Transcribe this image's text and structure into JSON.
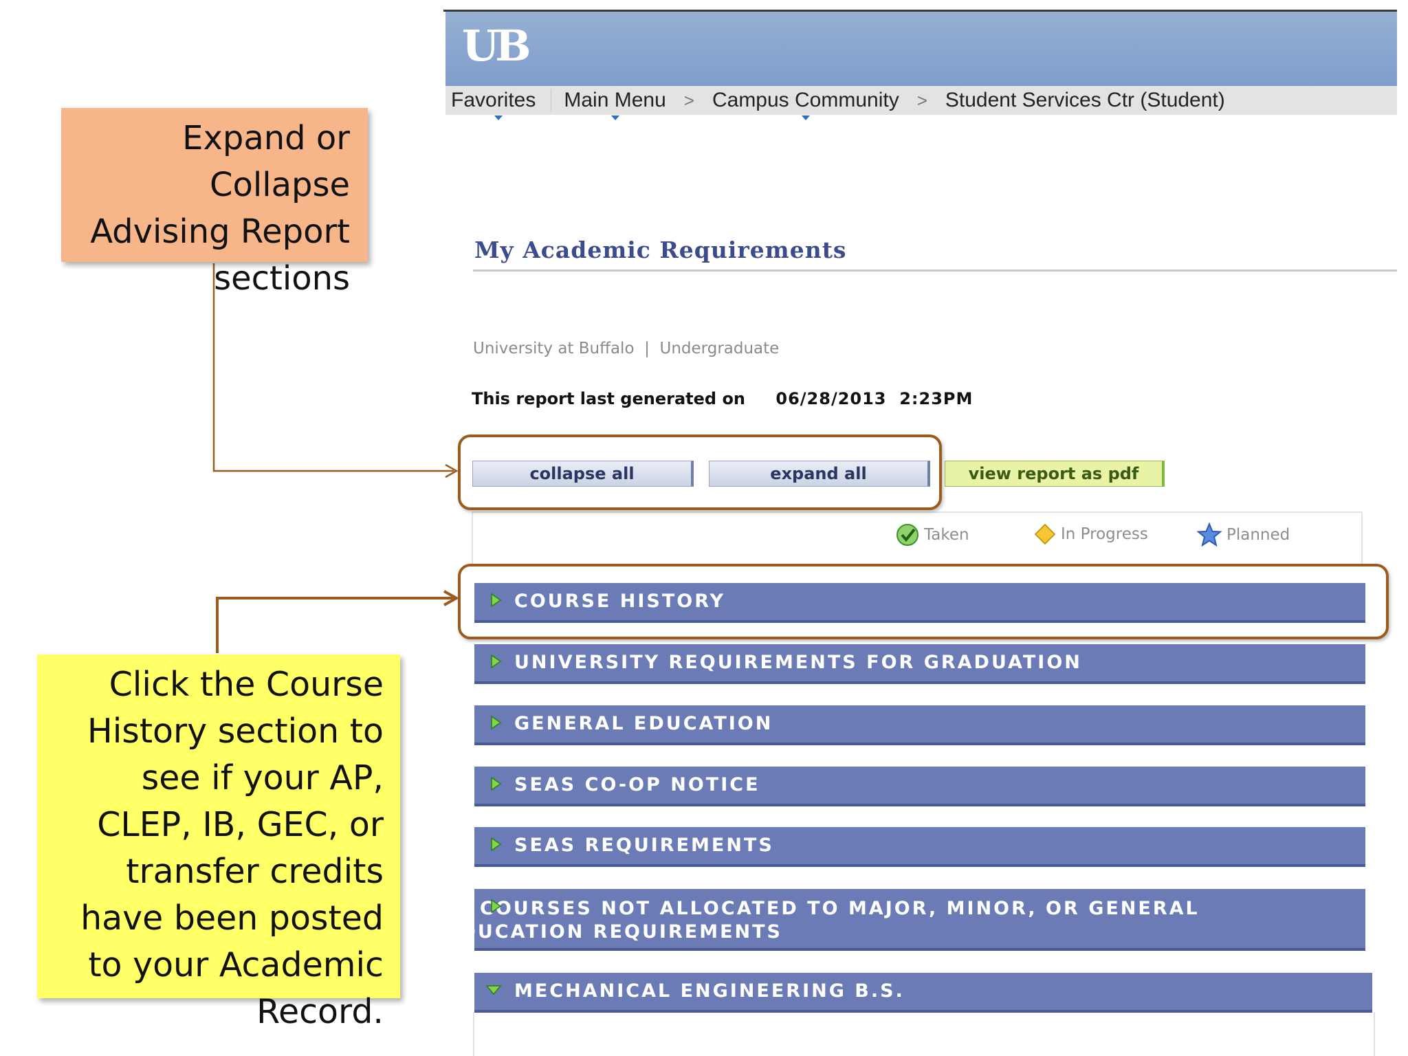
{
  "header": {
    "logo_text": "UB",
    "nav": [
      "Favorites",
      "Main Menu",
      "Campus Community",
      "Student Services Ctr (Student)"
    ],
    "nav_separator": ">"
  },
  "page": {
    "title": "My Academic Requirements",
    "institution_line": "University at Buffalo  |  Undergraduate",
    "generated_label": "This report last generated on",
    "generated_date": "06/28/2013  2:23PM"
  },
  "buttons": {
    "collapse_all": "collapse all",
    "expand_all": "expand all",
    "view_pdf": "view report as pdf"
  },
  "legend": {
    "taken": "Taken",
    "in_progress": "In Progress",
    "planned": "Planned"
  },
  "sections": [
    {
      "label": "COURSE HISTORY",
      "state": "collapsed"
    },
    {
      "label": "UNIVERSITY REQUIREMENTS FOR GRADUATION",
      "state": "collapsed"
    },
    {
      "label": "GENERAL EDUCATION",
      "state": "collapsed"
    },
    {
      "label": "SEAS CO-OP NOTICE",
      "state": "collapsed"
    },
    {
      "label": "SEAS REQUIREMENTS",
      "state": "collapsed"
    },
    {
      "label": "COURSES NOT ALLOCATED TO MAJOR, MINOR, OR GENERAL EDUCATION REQUIREMENTS",
      "state": "collapsed"
    },
    {
      "label": "MECHANICAL ENGINEERING B.S.",
      "state": "expanded"
    }
  ],
  "callouts": {
    "expand_collapse": "Expand or Collapse Advising Report sections",
    "course_history": "Click the Course History section to see if your AP, CLEP, IB, GEC, or transfer credits have been posted to your Academic Record."
  },
  "colors": {
    "section_bar": "#6b7bb5",
    "outline": "#9b5a1e",
    "callout_orange": "#f7b58a",
    "callout_yellow": "#ffff66",
    "title": "#3b4b8c"
  }
}
